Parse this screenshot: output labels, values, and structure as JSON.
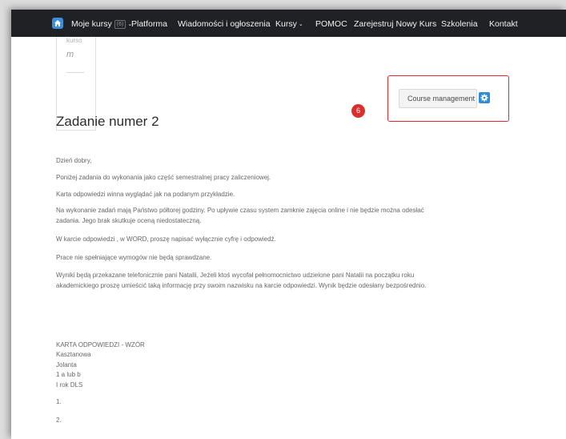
{
  "navbar": {
    "items": [
      {
        "label": "Moje kursy",
        "badge": "(6)",
        "has_caret": true
      },
      {
        "label": "Platforma"
      },
      {
        "label": "Wiadomości i ogłoszenia"
      },
      {
        "label": "Kursy",
        "has_caret": true
      },
      {
        "label": "POMOC"
      },
      {
        "label": "Zarejestruj Nowy Kurs"
      },
      {
        "label": "Szkolenia"
      },
      {
        "label": "Kontakt"
      }
    ],
    "caret": "⌄",
    "icon": "home-icon",
    "background": "#1f2124"
  },
  "side_card": {
    "cut_text": "kurso",
    "value": "m"
  },
  "step_badge": "6",
  "course_management": {
    "label": "Course management",
    "icon": "gear-icon",
    "accent": "#2f8dd6",
    "highlight_color": "#e0282e"
  },
  "content": {
    "title": "Zadanie numer 2",
    "paragraphs": [
      "Dzień dobry,",
      "Poniżej zadania do wykonania jako część semestralnej pracy zaliczeniowej.",
      "Karta odpowiedzi winna wyglądać jak na podanym przykładzie.",
      "Na wykonanie zadań mają Państwo półtorej godziny.  Po upływie czasu system zamknie zajęcia online i nie będzie można odesłać",
      "zadania. Jego brak skutkuje oceną niedostateczną.",
      "W karcie odpowiedzi , w WORD,  proszę napisać wyłącznie cyfrę i odpowiedź.",
      "Prace nie spełniające wymogów  nie będą sprawdzane.",
      "Wyniki będą przekazane telefonicznie pani Natalii, Jeżeli ktoś wycofał pełnomocnictwo udzielone pani Natalii na początku roku",
      "akademickiego proszę umieścić taką informację przy swoim nazwisku na karcie odpowiedzi. Wynik będzie odesłany bezpośrednio."
    ],
    "answer_card": [
      "KARTA ODPOWIEDZI - WZÓR",
      "Kasztanowa",
      "Jolanta",
      "1 a lub b",
      "I rok DLS"
    ],
    "numbers": [
      "1.",
      "2."
    ]
  }
}
